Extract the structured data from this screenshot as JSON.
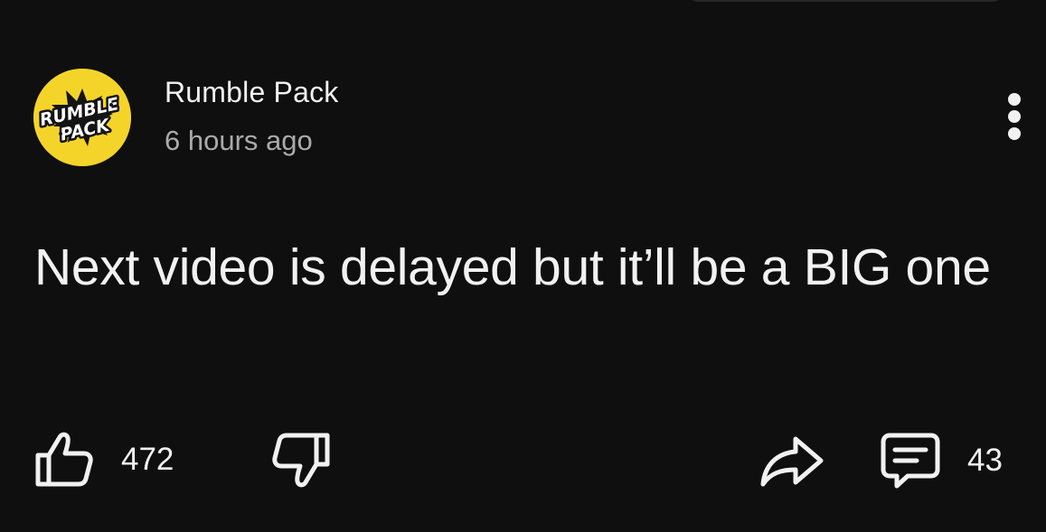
{
  "post": {
    "author": "Rumble Pack",
    "timestamp": "6 hours ago",
    "text": "Next video is delayed but it’ll be a BIG one",
    "avatar": {
      "line1": "RUMBLE",
      "line2": "PACK",
      "background": "#f5d42a"
    }
  },
  "actions": {
    "likes": "472",
    "comments": "43"
  },
  "icons": {
    "like": "thumbs-up-icon",
    "dislike": "thumbs-down-icon",
    "share": "share-arrow-icon",
    "comment": "comment-icon",
    "menu": "more-vertical-icon"
  },
  "colors": {
    "background": "#0f0f0f",
    "text_primary": "#f1f1f1",
    "text_secondary": "#aaaaaa"
  }
}
